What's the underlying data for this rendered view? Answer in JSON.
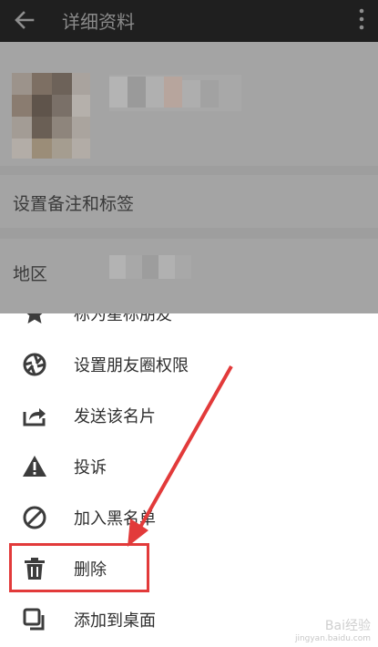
{
  "header": {
    "title": "详细资料",
    "back_icon": "arrow-left-icon",
    "more_icon": "more-vertical-icon"
  },
  "profile": {
    "remark_tags_label": "设置备注和标签",
    "region_label": "地区"
  },
  "menu": {
    "items": [
      {
        "label": "标为星标朋友",
        "icon": "star-icon"
      },
      {
        "label": "设置朋友圈权限",
        "icon": "aperture-icon"
      },
      {
        "label": "发送该名片",
        "icon": "share-icon"
      },
      {
        "label": "投诉",
        "icon": "warning-icon"
      },
      {
        "label": "加入黑名单",
        "icon": "block-icon"
      },
      {
        "label": "删除",
        "icon": "trash-icon"
      },
      {
        "label": "添加到桌面",
        "icon": "add-to-desktop-icon"
      }
    ]
  },
  "annotation": {
    "highlight_color": "#e23a3a",
    "highlighted_item": "删除"
  },
  "watermark": {
    "title": "Bai经验",
    "url": "jingyan.baidu.com"
  }
}
